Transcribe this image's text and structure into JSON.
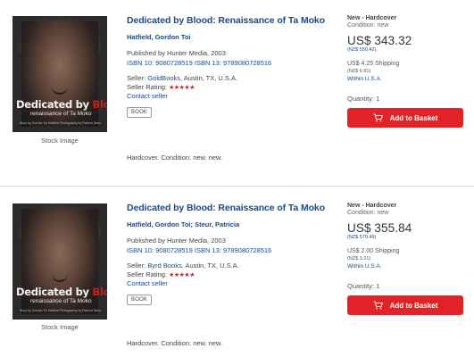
{
  "listings": [
    {
      "cover": {
        "title_white": "Dedicated by",
        "title_red": "Blood",
        "subtitle": "renaissance of Ta Moko",
        "credit": "Story by Gordon Toi Hatfield  Photography by Patricia Steur"
      },
      "stock_caption": "Stock Image",
      "title": "Dedicated by Blood: Renaissance of Ta Moko",
      "author": "Hatfield, Gordon Toi",
      "publisher": "Published by Hunter Media, 2003",
      "isbn": "ISBN 10: 9080728519   ISBN 13: 9789080728516",
      "seller_prefix": "Seller: ",
      "seller_name": "GoldBooks",
      "seller_location": ", Austin, TX, U.S.A.",
      "rating_label": "Seller Rating: ",
      "stars": "★★★★★",
      "contact": "Contact seller",
      "format_badge": "BOOK",
      "binding_condition": "Hardcover. Condition: new. new.",
      "condition_title": "New - Hardcover",
      "condition_sub": "Condition: new",
      "price": "US$ 343.32",
      "price_converted": "(NZ$ 550.42)",
      "shipping": "US$ 4.25 Shipping",
      "shipping_converted": "(NZ$ 6.81)",
      "within": "Within U.S.A.",
      "quantity": "Quantity: 1",
      "basket_label": "Add to Basket"
    },
    {
      "cover": {
        "title_white": "Dedicated by",
        "title_red": "Blood",
        "subtitle": "renaissance of Ta Moko",
        "credit": "Story by Gordon Toi Hatfield  Photography by Patricia Steur"
      },
      "stock_caption": "Stock Image",
      "title": "Dedicated by Blood: Renaissance of Ta Moko",
      "author": "Hatfield, Gordon Toi; Steur, Patricia",
      "publisher": "Published by Hunter Media, 2003",
      "isbn": "ISBN 10: 9080728519   ISBN 13: 9789080728516",
      "seller_prefix": "Seller: ",
      "seller_name": "Byrd Books",
      "seller_location": ", Austin, TX, U.S.A.",
      "rating_label": "Seller Rating: ",
      "stars": "★★★★★",
      "contact": "Contact seller",
      "format_badge": "BOOK",
      "binding_condition": "Hardcover. Condition: new. new.",
      "condition_title": "New - Hardcover",
      "condition_sub": "Condition: new",
      "price": "US$ 355.84",
      "price_converted": "(NZ$ 570.49)",
      "shipping": "US$ 2.00 Shipping",
      "shipping_converted": "(NZ$ 3.21)",
      "within": "Within U.S.A.",
      "quantity": "Quantity: 1",
      "basket_label": "Add to Basket"
    }
  ],
  "colors": {
    "link": "#1a4a87",
    "basket": "#e12327",
    "stars": "#c0272d"
  },
  "icons": {
    "basket": "shopping-cart-icon"
  }
}
